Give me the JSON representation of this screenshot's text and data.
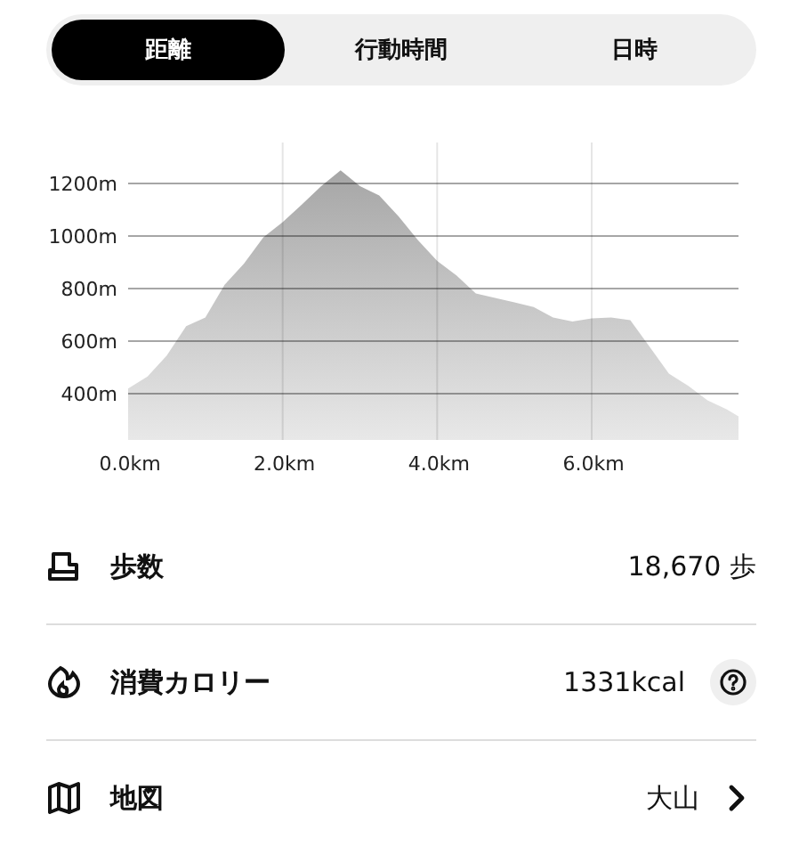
{
  "tabs": [
    {
      "label": "距離",
      "selected": true
    },
    {
      "label": "行動時間",
      "selected": false
    },
    {
      "label": "日時",
      "selected": false
    }
  ],
  "elevation": {
    "chart_data": {
      "type": "area",
      "x": [
        0,
        0.25,
        0.5,
        0.75,
        1,
        1.25,
        1.5,
        1.75,
        2,
        2.25,
        2.5,
        2.75,
        3,
        3.25,
        3.5,
        3.75,
        4,
        4.25,
        4.5,
        4.75,
        5,
        5.25,
        5.5,
        5.75,
        6,
        6.25,
        6.5,
        6.75,
        7,
        7.25,
        7.5,
        7.75,
        7.9
      ],
      "grid": true,
      "series": [
        {
          "color": "#a6a6a6",
          "values": [
            420,
            465,
            545,
            657,
            690,
            815,
            895,
            995,
            1053,
            1120,
            1190,
            1250,
            1190,
            1155,
            1075,
            985,
            905,
            850,
            782,
            765,
            748,
            730,
            690,
            675,
            687,
            690,
            680,
            578,
            476,
            430,
            375,
            340,
            314
          ]
        }
      ],
      "xlim": [
        0,
        7.9
      ],
      "ylim": [
        224,
        1356
      ],
      "xticks": [
        {
          "value": 0,
          "label": "0.0km"
        },
        {
          "value": 2,
          "label": "2.0km"
        },
        {
          "value": 4,
          "label": "4.0km"
        },
        {
          "value": 6,
          "label": "6.0km"
        }
      ],
      "yticks": [
        {
          "value": 400,
          "label": "400m"
        },
        {
          "value": 600,
          "label": "600m"
        },
        {
          "value": 800,
          "label": "800m"
        },
        {
          "value": 1000,
          "label": "1000m"
        },
        {
          "value": 1200,
          "label": "1200m"
        }
      ]
    }
  },
  "stats": [
    {
      "kind": "value",
      "label": "歩数",
      "value": "18,670 歩"
    },
    {
      "kind": "info",
      "label": "消費カロリー",
      "value": "1331kcal"
    },
    {
      "kind": "link",
      "label": "地図",
      "value": "大山"
    }
  ]
}
